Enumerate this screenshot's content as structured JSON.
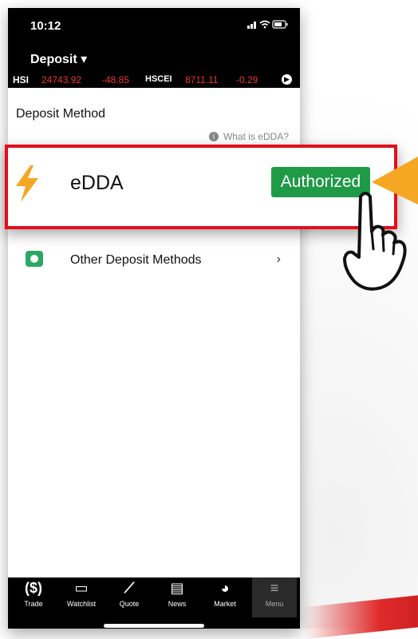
{
  "status": {
    "time": "10:12",
    "icons": "signal wifi battery"
  },
  "header": {
    "title": "Deposit ▾"
  },
  "ticker": {
    "hsi_label": "HSI",
    "hsi_value": "24743.92",
    "hsi_change": "-48.85",
    "hscei_label": "HSCEI",
    "hscei_value": "8711.11",
    "hscei_change": "-0.29"
  },
  "page": {
    "section_title": "Deposit Method",
    "help_link": "What is eDDA?"
  },
  "methods": {
    "edda": {
      "label": "eDDA",
      "status": "Authorized",
      "chevron": "›"
    },
    "other": {
      "label": "Other Deposit Methods",
      "chevron": "›"
    }
  },
  "nav": {
    "items": [
      {
        "label": "Trade",
        "icon": "($)"
      },
      {
        "label": "Watchlist",
        "icon": "▭"
      },
      {
        "label": "Quote",
        "icon": "⟋"
      },
      {
        "label": "News",
        "icon": "▤"
      },
      {
        "label": "Market",
        "icon": "◕"
      },
      {
        "label": "Menu",
        "icon": "≡"
      }
    ]
  },
  "colors": {
    "highlight_border": "#e30e1a",
    "authorized_green": "#1f9a46",
    "ticker_red": "#ee3333",
    "callout_orange": "#f5a623"
  }
}
